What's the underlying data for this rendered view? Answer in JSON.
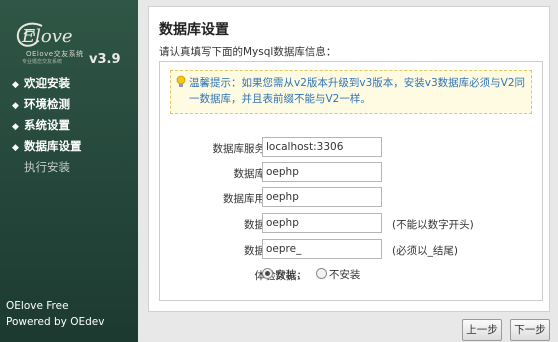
{
  "brand": {
    "logo_script": "Elove",
    "logo_sub": "OElove交友系统",
    "logo_tag": "专业婚恋交友系统",
    "version": "v3.9"
  },
  "nav": [
    {
      "label": "欢迎安装",
      "status": "done"
    },
    {
      "label": "环境检测",
      "status": "done"
    },
    {
      "label": "系统设置",
      "status": "done"
    },
    {
      "label": "数据库设置",
      "status": "current"
    },
    {
      "label": "执行安装",
      "status": "pending"
    }
  ],
  "sidebar_footer": {
    "line1": "OElove Free",
    "line2": "Powered by OEdev"
  },
  "page": {
    "title": "数据库设置",
    "intro": "请认真填写下面的Mysql数据库信息：",
    "notice": "温馨提示：如果您需从v2版本升级到v3版本，安装v3数据库必须与V2同一数据库，并且表前缀不能与V2一样。"
  },
  "form": {
    "db_host": {
      "label": "数据库服务器地址：",
      "value": "localhost:3306"
    },
    "db_user": {
      "label": "数据库用户名：",
      "value": "oephp"
    },
    "db_pass": {
      "label": "数据库用户密码：",
      "value": "oephp"
    },
    "db_name": {
      "label": "数据库名称：",
      "value": "oephp",
      "hint": "(不能以数字开头)"
    },
    "db_prefix": {
      "label": "数据表前缀：",
      "value": "oepre_",
      "hint": "(必须以_结尾)"
    },
    "demo_data": {
      "label": "体验数据：",
      "options": [
        "安装，",
        "不安装"
      ],
      "selected": "安装，"
    }
  },
  "buttons": {
    "prev": "上一步",
    "next": "下一步"
  },
  "colors": {
    "sidebar_bg": "#2f5646",
    "notice_text": "#2f74b5",
    "notice_bg": "#fffbe2"
  }
}
